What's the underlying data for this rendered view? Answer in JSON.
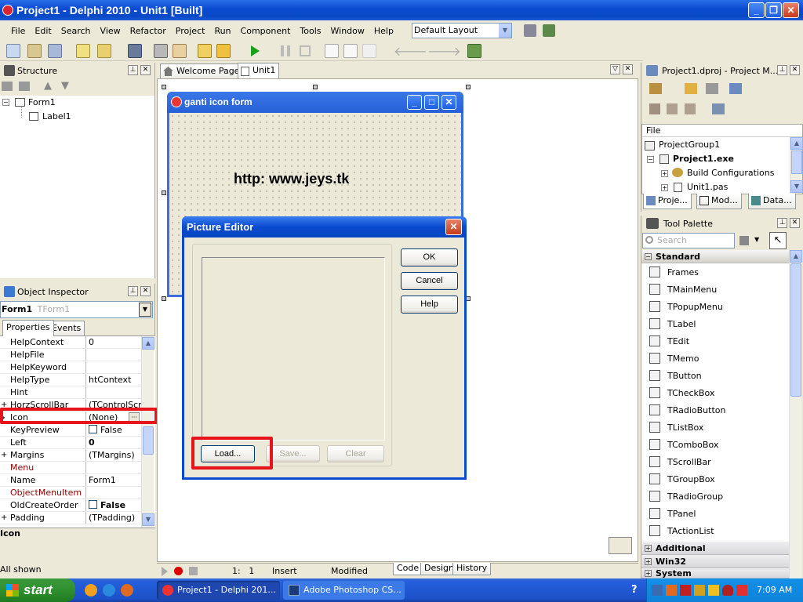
{
  "window": {
    "title": "Project1 - Delphi 2010 - Unit1 [Built]"
  },
  "menu": [
    "File",
    "Edit",
    "Search",
    "View",
    "Refactor",
    "Project",
    "Run",
    "Component",
    "Tools",
    "Window",
    "Help"
  ],
  "layout_select": "Default Layout",
  "structure": {
    "title": "Structure",
    "nodes": [
      "Form1",
      "Label1"
    ]
  },
  "editor_tabs": [
    "Welcome Page",
    "Unit1"
  ],
  "form": {
    "caption": "ganti icon form",
    "label": "http: www.jeys.tk"
  },
  "picture_editor": {
    "title": "Picture Editor",
    "ok": "OK",
    "cancel": "Cancel",
    "help": "Help",
    "load": "Load...",
    "save": "Save...",
    "clear": "Clear"
  },
  "object_inspector": {
    "title": "Object Inspector",
    "selected": "Form1",
    "selected_type": "TForm1",
    "tabs": [
      "Properties",
      "Events"
    ],
    "rows": [
      {
        "name": "HelpContext",
        "value": "0"
      },
      {
        "name": "HelpFile",
        "value": ""
      },
      {
        "name": "HelpKeyword",
        "value": ""
      },
      {
        "name": "HelpType",
        "value": "htContext"
      },
      {
        "name": "Hint",
        "value": ""
      },
      {
        "name": "HorzScrollBar",
        "value": "(TControlScro"
      },
      {
        "name": "Icon",
        "value": "(None)"
      },
      {
        "name": "KeyPreview",
        "value": "False"
      },
      {
        "name": "Left",
        "value": "0"
      },
      {
        "name": "Margins",
        "value": "(TMargins)"
      },
      {
        "name": "Menu",
        "value": ""
      },
      {
        "name": "Name",
        "value": "Form1"
      },
      {
        "name": "ObjectMenuItem",
        "value": ""
      },
      {
        "name": "OldCreateOrder",
        "value": "False"
      },
      {
        "name": "Padding",
        "value": "(TPadding)"
      }
    ],
    "footer_prop": "Icon",
    "status": "All shown"
  },
  "editor_status": {
    "pos": "1:   1",
    "mode": "Insert",
    "state": "Modified",
    "tabs": [
      "Code",
      "Design",
      "History"
    ]
  },
  "project_manager": {
    "title": "Project1.dproj - Project M...",
    "header": "File",
    "nodes": [
      "ProjectGroup1",
      "Project1.exe",
      "Build Configurations",
      "Unit1.pas"
    ],
    "tabs": [
      "Proje...",
      "Mod...",
      "Data..."
    ]
  },
  "tool_palette": {
    "title": "Tool Palette",
    "search_placeholder": "Search",
    "category": "Standard",
    "items": [
      "Frames",
      "TMainMenu",
      "TPopupMenu",
      "TLabel",
      "TEdit",
      "TMemo",
      "TButton",
      "TCheckBox",
      "TRadioButton",
      "TListBox",
      "TComboBox",
      "TScrollBar",
      "TGroupBox",
      "TRadioGroup",
      "TPanel",
      "TActionList"
    ],
    "more_categories": [
      "Additional",
      "Win32",
      "System"
    ]
  },
  "taskbar": {
    "start": "start",
    "tasks": [
      "Project1 - Delphi 201...",
      "Adobe Photoshop CS..."
    ],
    "clock": "7:09 AM"
  },
  "colors": {
    "highlight": "#e8141c",
    "titlebar": "#0a4ad0",
    "taskbar": "#245edb"
  }
}
